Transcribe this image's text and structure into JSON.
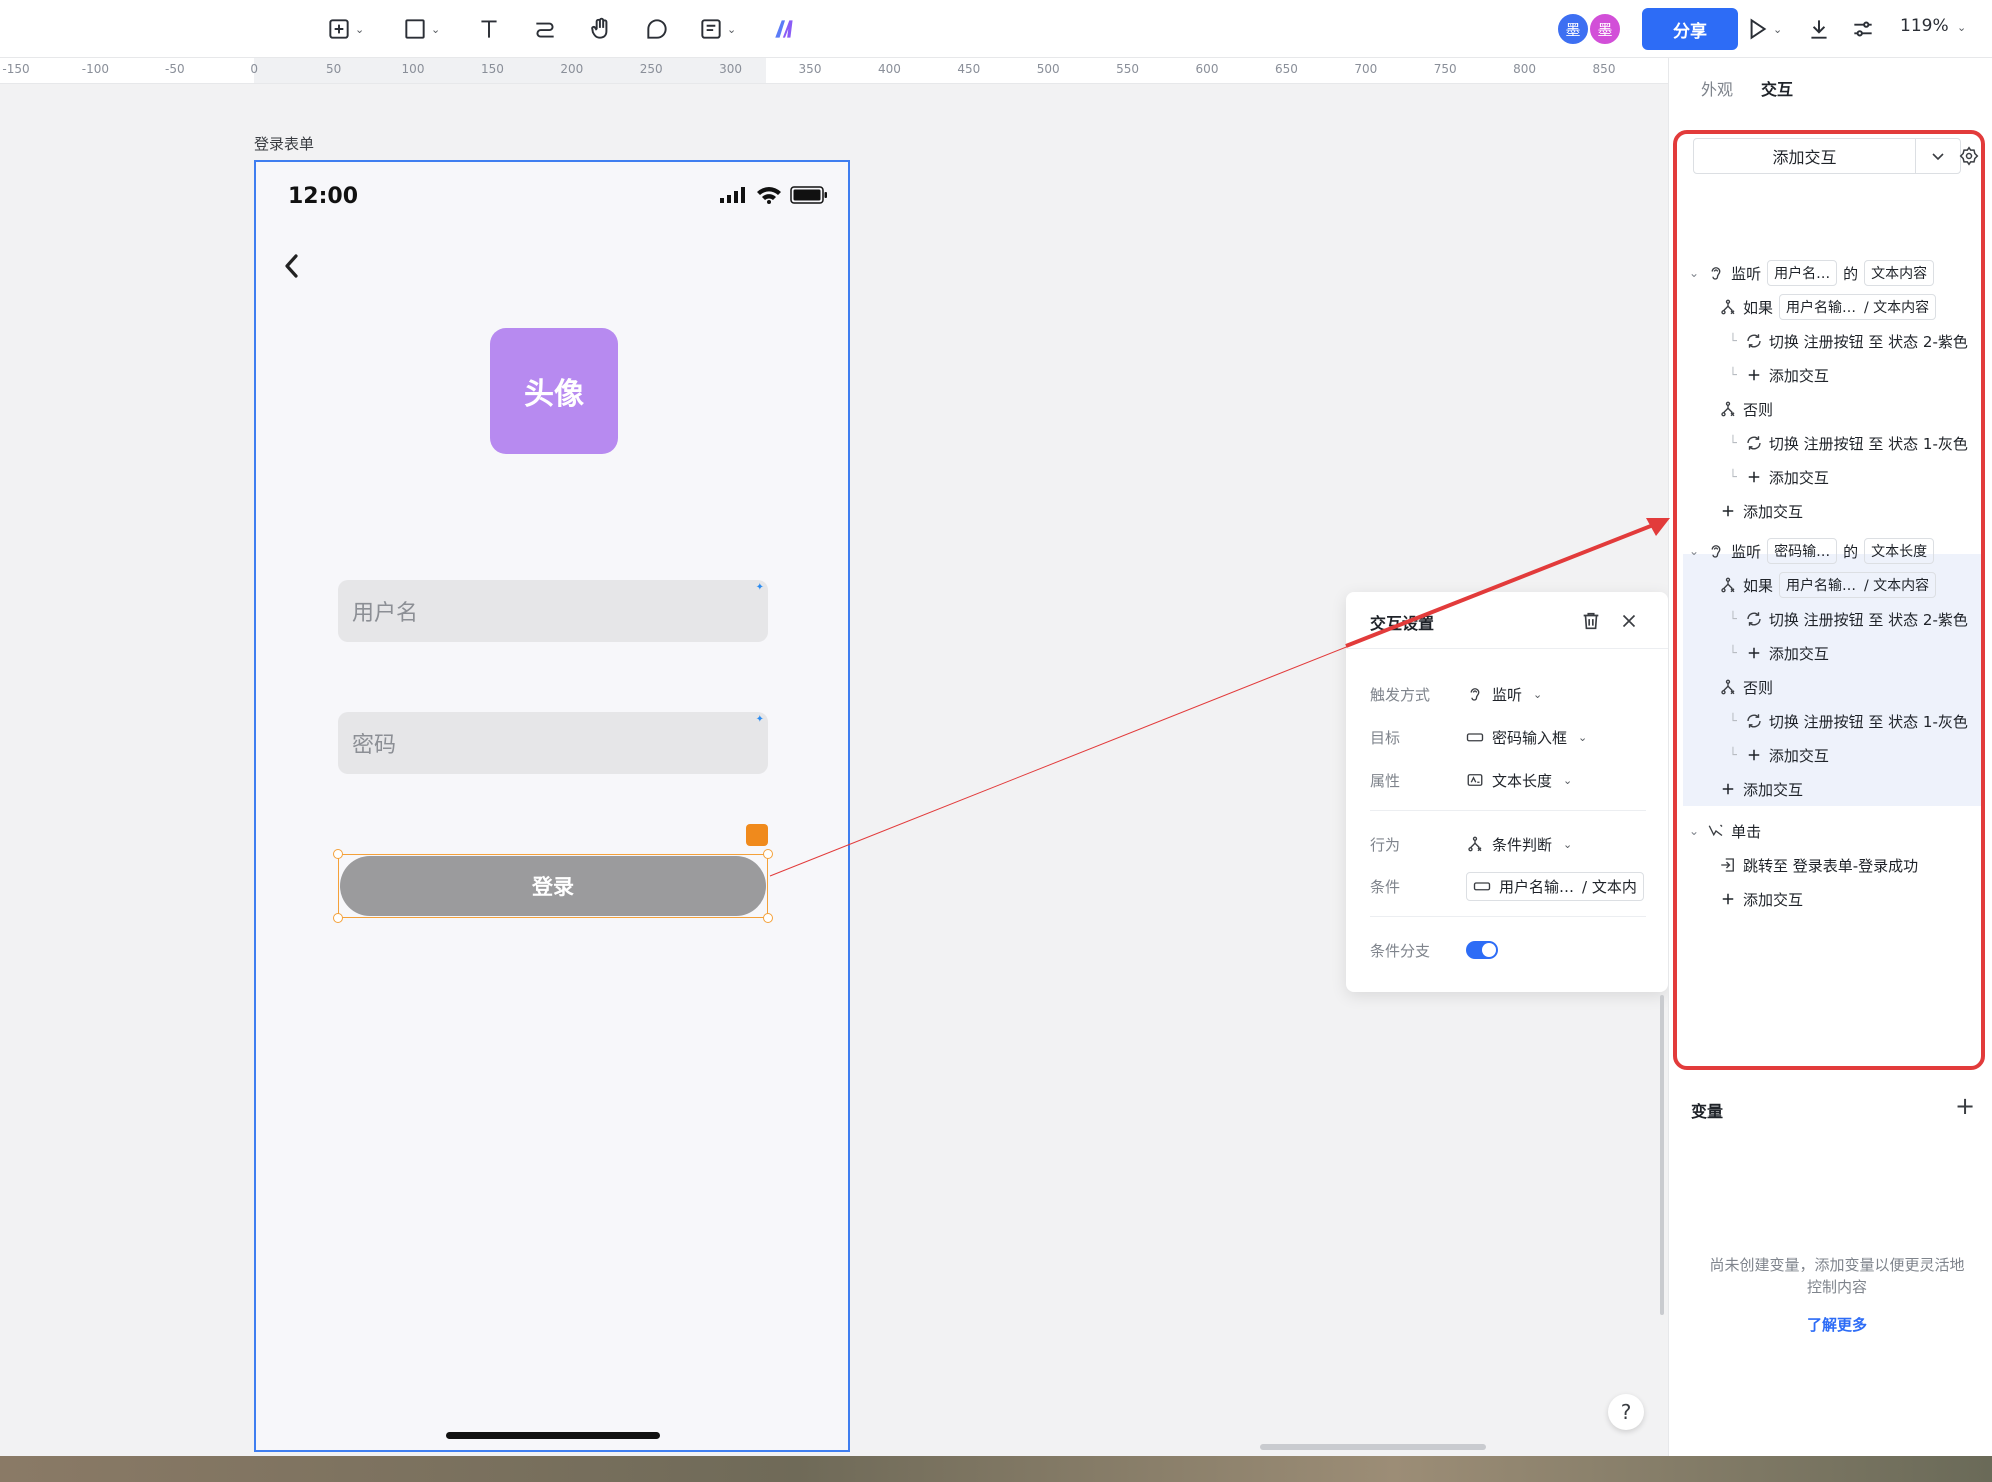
{
  "toolbar": {
    "share_label": "分享",
    "zoom": "119%",
    "collaborators": [
      {
        "initial": "墨",
        "color": "#3d6ff2"
      },
      {
        "initial": "墨",
        "color": "#d24fd8"
      }
    ]
  },
  "ruler": {
    "ticks": [
      "-150",
      "-100",
      "-50",
      "0",
      "50",
      "100",
      "150",
      "200",
      "250",
      "300",
      "350",
      "400",
      "450",
      "500",
      "550",
      "600",
      "650",
      "700",
      "750",
      "800",
      "850"
    ]
  },
  "frame": {
    "label": "登录表单",
    "status_time": "12:00",
    "avatar_text": "头像",
    "username_placeholder": "用户名",
    "password_placeholder": "密码",
    "login_label": "登录"
  },
  "popover": {
    "title": "交互设置",
    "rows": {
      "trigger": {
        "label": "触发方式",
        "value": "监听"
      },
      "target": {
        "label": "目标",
        "value": "密码输入框"
      },
      "property": {
        "label": "属性",
        "value": "文本长度"
      },
      "action": {
        "label": "行为",
        "value": "条件判断"
      },
      "condition": {
        "label": "条件",
        "value_a": "用户名输…",
        "value_b": "/ 文本内"
      },
      "branch": {
        "label": "条件分支"
      }
    }
  },
  "panel": {
    "tabs": [
      "外观",
      "交互"
    ],
    "add_interaction": "添加交互",
    "tree": {
      "listen": "监听",
      "of": "的",
      "if": "如果",
      "else": "否则",
      "switch": "切换 注册按钮 至 状态 2-紫色",
      "switch_gray": "切换 注册按钮 至 状态 1-灰色",
      "add": "添加交互",
      "group1_target": "用户名…",
      "group1_prop": "文本内容",
      "group2_target": "密码输…",
      "group2_prop": "文本长度",
      "cond_target": "用户名输…",
      "cond_prop": "/ 文本内容",
      "click": "单击",
      "jump": "跳转至 登录表单-登录成功"
    },
    "variables": {
      "title": "变量",
      "empty_text": "尚未创建变量，添加变量以便更灵活地控制内容",
      "learn_more": "了解更多"
    }
  },
  "help": "?"
}
